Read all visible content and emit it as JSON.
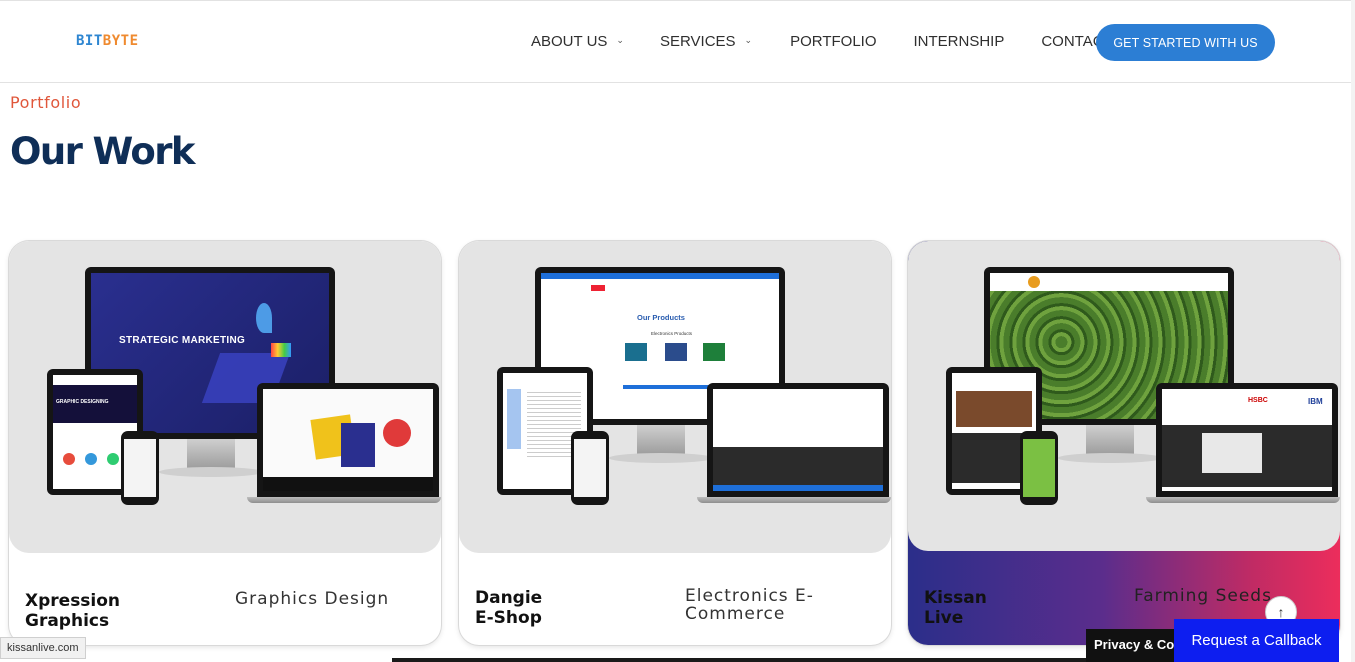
{
  "header": {
    "logo": {
      "part1": "BIT",
      "part2": "BYTE"
    },
    "nav": [
      {
        "label": "ABOUT US",
        "has_dropdown": true
      },
      {
        "label": "SERVICES",
        "has_dropdown": true
      },
      {
        "label": "PORTFOLIO",
        "has_dropdown": false
      },
      {
        "label": "INTERNSHIP",
        "has_dropdown": false
      },
      {
        "label": "CONTACT",
        "has_dropdown": false
      }
    ],
    "cta_label": "GET STARTED WITH US"
  },
  "section": {
    "eyebrow": "Portfolio",
    "title": "Our Work"
  },
  "projects": [
    {
      "name": "Xpression\nGraphics",
      "category": "Graphics Design",
      "screen_text": "STRATEGIC MARKETING",
      "tablet_text": "GRAPHIC DESIGNING"
    },
    {
      "name": "Dangie\nE-Shop",
      "category": "Electronics E-\nCommerce",
      "screen_text": "Our Products",
      "sub_text": "Electronics Products"
    },
    {
      "name": "Kissan\nLive",
      "category": "Farming Seeds",
      "partner_logos": [
        "HSBC",
        "IBM"
      ]
    }
  ],
  "overlays": {
    "status_url": "kissanlive.com",
    "privacy_label": "Privacy & Cookies",
    "callback_label": "Request a Callback",
    "back_to_top_icon": "arrow-up-icon"
  },
  "colors": {
    "brand_blue": "#2c7ed4",
    "eyebrow_red": "#e0573b",
    "title_navy": "#0f2e57",
    "callback_blue": "#0d1ef0"
  }
}
